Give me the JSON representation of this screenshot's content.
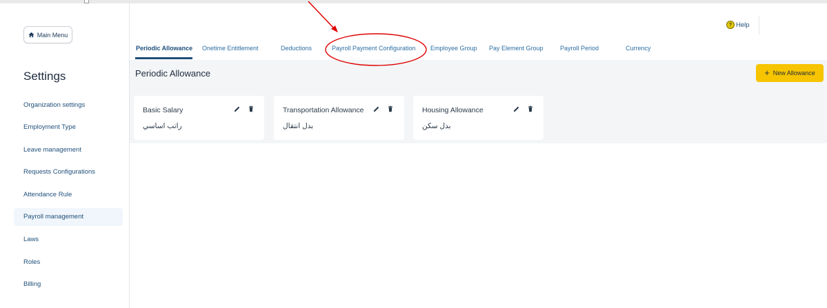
{
  "sidebar": {
    "main_menu_label": "Main Menu",
    "title": "Settings",
    "items": [
      {
        "label": "Organization settings"
      },
      {
        "label": "Employment Type"
      },
      {
        "label": "Leave management"
      },
      {
        "label": "Requests Configurations"
      },
      {
        "label": "Attendance Rule"
      },
      {
        "label": "Payroll management"
      },
      {
        "label": "Laws"
      },
      {
        "label": "Roles"
      },
      {
        "label": "Billing"
      }
    ],
    "active_item": "Payroll management"
  },
  "header": {
    "help_label": "Help",
    "help_icon": "question-circle-icon"
  },
  "tabs": [
    {
      "label": "Periodic Allowance",
      "active": true
    },
    {
      "label": "Onetime Entitlement"
    },
    {
      "label": "Deductions"
    },
    {
      "label": "Payroll Payment Configuration"
    },
    {
      "label": "Employee Group"
    },
    {
      "label": "Pay Element Group"
    },
    {
      "label": "Payroll Period"
    },
    {
      "label": "Currency"
    }
  ],
  "main": {
    "page_title": "Periodic Allowance",
    "new_button_label": "New Allowance",
    "cards": [
      {
        "title": "Basic Salary",
        "subtitle": "راتب اساسي"
      },
      {
        "title": "Transportation Allowance",
        "subtitle": "بدل انتقال"
      },
      {
        "title": "Housing Allowance",
        "subtitle": "بدل سكن"
      }
    ]
  },
  "colors": {
    "accent": "#f7c400",
    "nav_text": "#1f4f7a",
    "annotation": "#e00000",
    "content_bg": "#f3f5f7"
  }
}
